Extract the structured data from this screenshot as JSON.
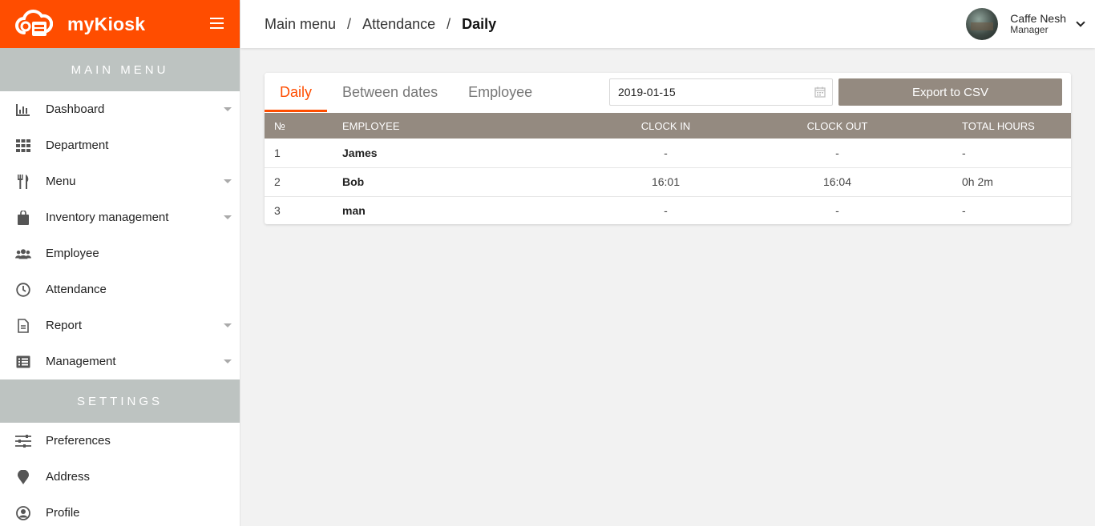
{
  "brand": {
    "name": "myKiosk",
    "color": "#ff4d00"
  },
  "sidebar": {
    "main_menu_title": "MAIN MENU",
    "main_items": [
      {
        "label": "Dashboard",
        "icon": "bar-chart-icon",
        "has_submenu": true
      },
      {
        "label": "Department",
        "icon": "grid-icon",
        "has_submenu": false
      },
      {
        "label": "Menu",
        "icon": "fork-knife-icon",
        "has_submenu": true
      },
      {
        "label": "Inventory management",
        "icon": "shopping-bag-icon",
        "has_submenu": true
      },
      {
        "label": "Employee",
        "icon": "users-icon",
        "has_submenu": false
      },
      {
        "label": "Attendance",
        "icon": "clock-icon",
        "has_submenu": false
      },
      {
        "label": "Report",
        "icon": "document-icon",
        "has_submenu": true
      },
      {
        "label": "Management",
        "icon": "list-icon",
        "has_submenu": true
      }
    ],
    "settings_title": "SETTINGS",
    "settings_items": [
      {
        "label": "Preferences",
        "icon": "sliders-icon"
      },
      {
        "label": "Address",
        "icon": "map-pin-icon"
      },
      {
        "label": "Profile",
        "icon": "user-circle-icon"
      }
    ]
  },
  "header": {
    "breadcrumb": [
      "Main menu",
      "Attendance",
      "Daily"
    ],
    "separator": "/",
    "user": {
      "name": "Caffe Nesh",
      "role": "Manager"
    }
  },
  "attendance": {
    "tabs": [
      "Daily",
      "Between dates",
      "Employee"
    ],
    "active_tab": "Daily",
    "date_value": "2019-01-15",
    "export_label": "Export to CSV",
    "columns": [
      "№",
      "EMPLOYEE",
      "CLOCK IN",
      "CLOCK OUT",
      "TOTAL HOURS"
    ],
    "rows": [
      {
        "num": "1",
        "employee": "James",
        "clock_in": "-",
        "clock_out": "-",
        "total": "-"
      },
      {
        "num": "2",
        "employee": "Bob",
        "clock_in": "16:01",
        "clock_out": "16:04",
        "total": "0h 2m"
      },
      {
        "num": "3",
        "employee": "man",
        "clock_in": "-",
        "clock_out": "-",
        "total": "-"
      }
    ]
  }
}
